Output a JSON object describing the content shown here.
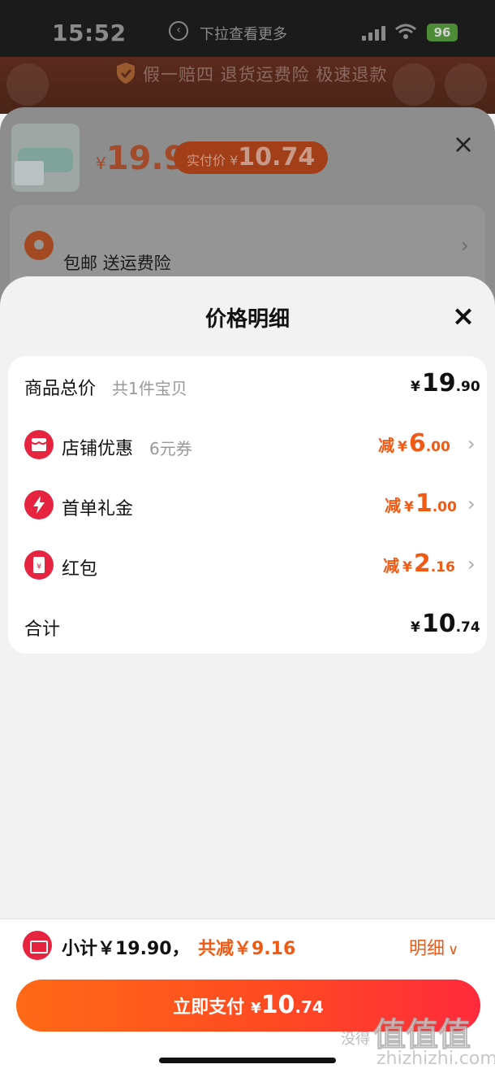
{
  "status_bar": {
    "time": "15:52",
    "hint": "下拉查看更多",
    "battery": "96"
  },
  "background": {
    "guarantee": "假一赔四 退货运费险 极速退款",
    "product_price_symbol": "¥",
    "product_price": "19.9",
    "paid_label": "实付价",
    "paid_symbol": "¥",
    "paid_amount": "10.74",
    "shipping": "包邮  送运费险"
  },
  "modal": {
    "title": "价格明细",
    "rows": [
      {
        "label": "商品总价",
        "sub": "共1件宝贝",
        "prefix": "",
        "symbol": "¥",
        "int": "19",
        "dec": ".90",
        "icon": ""
      },
      {
        "label": "店铺优惠",
        "sub": "6元券",
        "prefix": "减",
        "symbol": "¥",
        "int": "6",
        "dec": ".00",
        "icon": "shop-icon"
      },
      {
        "label": "首单礼金",
        "sub": "",
        "prefix": "减",
        "symbol": "¥",
        "int": "1",
        "dec": ".00",
        "icon": "lightning-icon"
      },
      {
        "label": "红包",
        "sub": "",
        "prefix": "减",
        "symbol": "¥",
        "int": "2",
        "dec": ".16",
        "icon": "red-envelope-icon"
      },
      {
        "label": "合计",
        "sub": "",
        "prefix": "",
        "symbol": "¥",
        "int": "10",
        "dec": ".74",
        "icon": ""
      }
    ]
  },
  "bottom": {
    "subtotal": "小计￥19.90，",
    "saved": "共减￥9.16",
    "detail_toggle": "明细",
    "pay_label": "立即支付",
    "pay_symbol": "¥",
    "pay_int": "10",
    "pay_dec": ".74"
  },
  "watermark": {
    "big": "值值值",
    "small": "没得",
    "url": "zhizhizhi.com"
  },
  "colors": {
    "accent": "#f05a14",
    "brand_red": "#e6243f",
    "pay_gradient_start": "#ff6a17",
    "pay_gradient_end": "#ff2a3c"
  }
}
